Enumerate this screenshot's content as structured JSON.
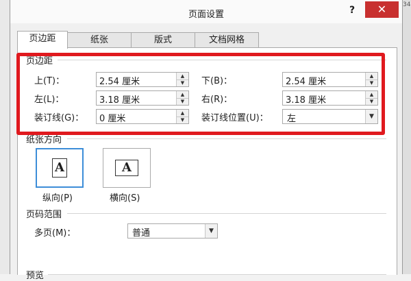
{
  "dialog": {
    "title": "页面设置",
    "help_label": "?",
    "close_label": "✕",
    "background_right_text": "34"
  },
  "tabs": [
    {
      "label": "页边距",
      "active": true
    },
    {
      "label": "纸张",
      "active": false
    },
    {
      "label": "版式",
      "active": false
    },
    {
      "label": "文档网格",
      "active": false
    }
  ],
  "margins": {
    "group_title": "页边距",
    "top_label": "上(T)：",
    "top_value": "2.54 厘米",
    "bottom_label": "下(B)：",
    "bottom_value": "2.54 厘米",
    "left_label": "左(L)：",
    "left_value": "3.18 厘米",
    "right_label": "右(R)：",
    "right_value": "3.18 厘米",
    "gutter_label": "装订线(G)：",
    "gutter_value": "0 厘米",
    "gutter_position_label": "装订线位置(U)：",
    "gutter_position_value": "左"
  },
  "orientation": {
    "group_title": "纸张方向",
    "portrait_label": "纵向(P)",
    "landscape_label": "横向(S)",
    "selected": "portrait"
  },
  "pages": {
    "group_title": "页码范围",
    "multiple_label": "多页(M)：",
    "multiple_value": "普通"
  },
  "preview": {
    "group_title": "预览"
  },
  "highlight_color": "#e0191e",
  "icons": {
    "spin_up": "▲",
    "spin_down": "▼",
    "dropdown": "▼"
  }
}
